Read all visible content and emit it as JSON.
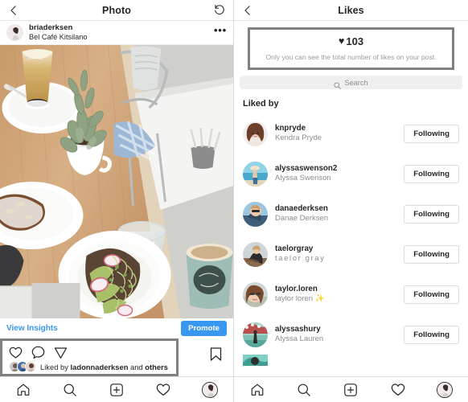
{
  "left": {
    "topbar": {
      "title": "Photo",
      "back_icon": "chevron-left-icon",
      "refresh_icon": "refresh-counterclockwise-icon"
    },
    "post": {
      "username": "briaderksen",
      "location": "Bel Café Kitsilano",
      "more_icon": "more-options-icon",
      "photo_alt": "Overhead café table with latte, potted succulent, powdered pastry, avocado toast and teal coffee cup"
    },
    "insights": {
      "link_label": "View Insights",
      "promote_label": "Promote"
    },
    "actions": {
      "like_icon": "heart-icon",
      "comment_icon": "comment-bubble-icon",
      "share_icon": "paper-plane-icon",
      "save_icon": "bookmark-icon",
      "liked_prefix": "Liked by ",
      "liked_user": "ladonnaderksen",
      "liked_middle": " and ",
      "liked_others": "others"
    }
  },
  "right": {
    "topbar": {
      "title": "Likes",
      "back_icon": "chevron-left-icon"
    },
    "likes_summary": {
      "heart_icon": "heart-filled-icon",
      "count": "103",
      "note": "Only you can see the total number of likes on your post."
    },
    "search": {
      "placeholder": "Search",
      "icon": "search-icon"
    },
    "section_title": "Liked by",
    "users": [
      {
        "username": "knpryde",
        "fullname": "Kendra Pryde",
        "button": "Following",
        "spaced": false
      },
      {
        "username": "alyssaswenson2",
        "fullname": "Alyssa Swenson",
        "button": "Following",
        "spaced": false
      },
      {
        "username": "danaederksen",
        "fullname": "Danae Derksen",
        "button": "Following",
        "spaced": false
      },
      {
        "username": "taelorgray",
        "fullname": "taelor gray",
        "button": "Following",
        "spaced": true
      },
      {
        "username": "taylor.loren",
        "fullname": "taylor loren ✨",
        "button": "Following",
        "spaced": false
      },
      {
        "username": "alyssashury",
        "fullname": "Alyssa Lauren",
        "button": "Following",
        "spaced": false
      }
    ]
  },
  "tabbar": {
    "home_icon": "home-icon",
    "search_icon": "search-icon",
    "add_icon": "add-post-icon",
    "activity_icon": "heart-icon",
    "profile_icon": "profile-avatar-icon"
  },
  "colors": {
    "accent_blue": "#3897f0",
    "text_primary": "#262626",
    "text_secondary": "#8e8e8e",
    "highlight_border": "#808080",
    "divider": "#dbdbdb"
  }
}
